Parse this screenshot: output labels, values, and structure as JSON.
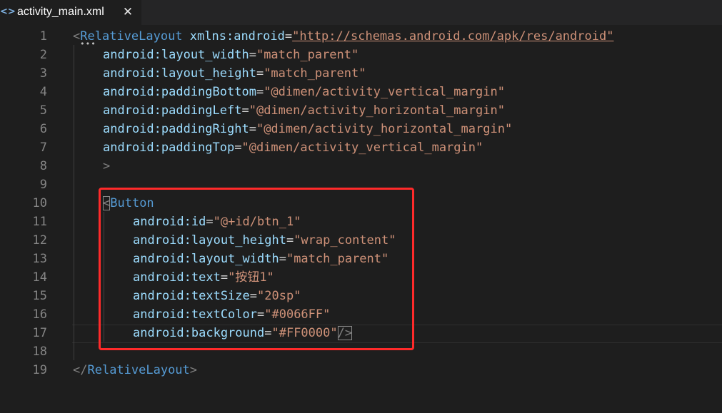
{
  "tab": {
    "icon": "xml-code-icon",
    "icon_glyph": "<>",
    "title": "activity_main.xml",
    "close_glyph": "✕"
  },
  "editor": {
    "line_numbers": [
      "1",
      "2",
      "3",
      "4",
      "5",
      "6",
      "7",
      "8",
      "9",
      "10",
      "11",
      "12",
      "13",
      "14",
      "15",
      "16",
      "17",
      "18",
      "19"
    ],
    "root_tag": "RelativeLayout",
    "ns_attr": "xmlns:android",
    "ns_value": "\"http://schemas.android.com/apk/res/android\"",
    "root_attrs": [
      {
        "name": "android:layout_width",
        "value": "\"match_parent\""
      },
      {
        "name": "android:layout_height",
        "value": "\"match_parent\""
      },
      {
        "name": "android:paddingBottom",
        "value": "\"@dimen/activity_vertical_margin\""
      },
      {
        "name": "android:paddingLeft",
        "value": "\"@dimen/activity_horizontal_margin\""
      },
      {
        "name": "android:paddingRight",
        "value": "\"@dimen/activity_horizontal_margin\""
      },
      {
        "name": "android:paddingTop",
        "value": "\"@dimen/activity_vertical_margin\""
      }
    ],
    "close_bracket": ">",
    "child_tag": "Button",
    "child_attrs": [
      {
        "name": "android:id",
        "value": "\"@+id/btn_1\""
      },
      {
        "name": "android:layout_height",
        "value": "\"wrap_content\""
      },
      {
        "name": "android:layout_width",
        "value": "\"match_parent\""
      },
      {
        "name": "android:text",
        "value": "\"按钮1\""
      },
      {
        "name": "android:textSize",
        "value": "\"20sp\""
      },
      {
        "name": "android:textColor",
        "value": "\"#0066FF\""
      },
      {
        "name": "android:background",
        "value": "\"#FF0000\""
      }
    ],
    "self_close": "/>",
    "end_tag": "</RelativeLayout>"
  },
  "colors": {
    "background": "#1e1e1e",
    "tag_name": "#569cd6",
    "attribute": "#9cdcfe",
    "string": "#ce9178",
    "highlight_box": "#ff2a2a"
  }
}
